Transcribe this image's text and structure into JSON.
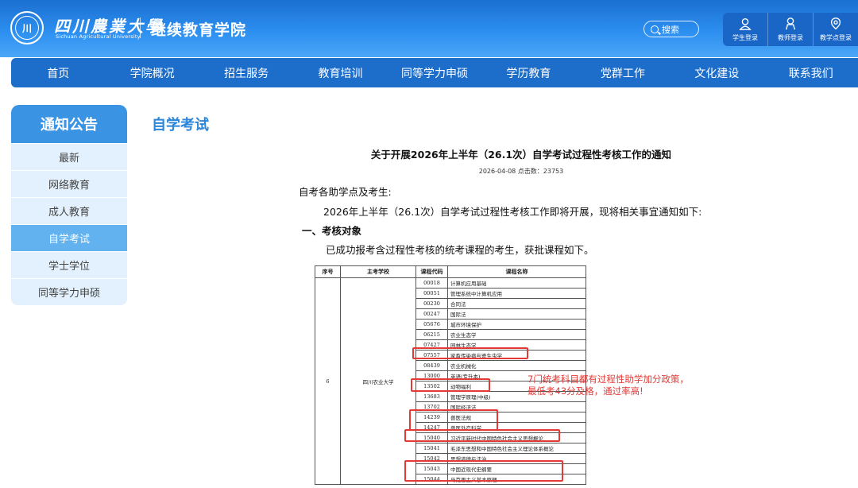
{
  "header": {
    "uni_name": "四川農業大學",
    "uni_name_en": "Sichuan Agricultural University",
    "college_name": "继续教育学院",
    "search_placeholder": "搜索",
    "logins": [
      "学生登录",
      "教师登录",
      "教学点登录"
    ]
  },
  "nav": [
    "首页",
    "学院概况",
    "招生服务",
    "教育培训",
    "同等学力申硕",
    "学历教育",
    "党群工作",
    "文化建设",
    "联系我们"
  ],
  "sidebar": {
    "title": "通知公告",
    "items": [
      "最新",
      "网络教育",
      "成人教育",
      "自学考试",
      "学士学位",
      "同等学力申硕"
    ],
    "active": "自学考试"
  },
  "main": {
    "section_title": "自学考试",
    "article_title": "关于开展2026年上半年（26.1次）自学考试过程性考核工作的通知",
    "meta": "2026-04-08 点击数：23753",
    "p1": "自考各助学点及考生:",
    "p2": "2026年上半年（26.1次）自学考试过程性考核工作即将开展，现将相关事宜通知如下:",
    "p3": "一、考核对象",
    "p4": "已成功报考含过程性考核的统考课程的考生，获批课程如下。"
  },
  "table": {
    "headers": [
      "序号",
      "主考学校",
      "课程代码",
      "课程名称"
    ],
    "seq": "6",
    "school": "四川农业大学",
    "rows": [
      [
        "00018",
        "计算机应用基础"
      ],
      [
        "00051",
        "管理系统中计算机应用"
      ],
      [
        "00230",
        "合同法"
      ],
      [
        "00247",
        "国际法"
      ],
      [
        "05676",
        "城市环境保护"
      ],
      [
        "06215",
        "农业生态学"
      ],
      [
        "07427",
        "园林生态学"
      ],
      [
        "07557",
        "家畜传染病与寄生虫学"
      ],
      [
        "08439",
        "农业机械化"
      ],
      [
        "13000",
        "英语(专升本)"
      ],
      [
        "13502",
        "动物福利"
      ],
      [
        "13683",
        "管理学原理(中级)"
      ],
      [
        "13702",
        "国际经济法"
      ],
      [
        "14239",
        "兽医法规"
      ],
      [
        "14247",
        "兽医外产科学"
      ],
      [
        "15040",
        "习近平新时代中国特色社会主义思想概论"
      ],
      [
        "15041",
        "毛泽东思想和中国特色社会主义理论体系概论"
      ],
      [
        "15042",
        "思想道德与法治"
      ],
      [
        "15043",
        "中国近现代史纲要"
      ],
      [
        "15044",
        "马克思主义基本原理"
      ]
    ]
  },
  "annotation": {
    "line1": "7门统考科目都有过程性助学加分政策，",
    "line2": "最低考43分及格，通过率高!",
    "color": "#e53935"
  }
}
